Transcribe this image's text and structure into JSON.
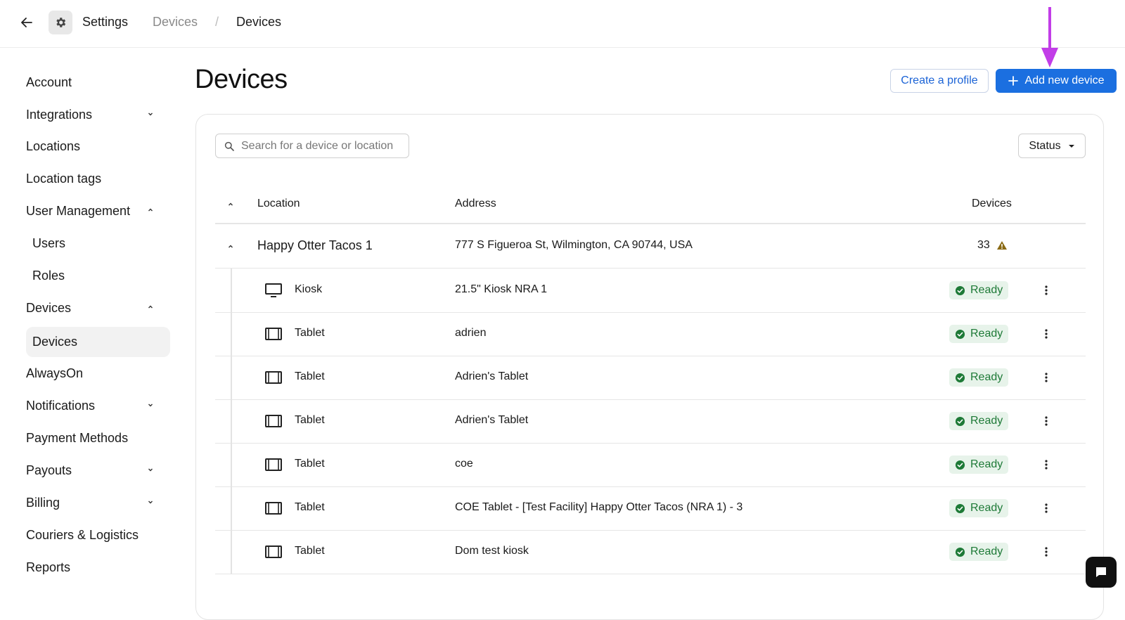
{
  "header": {
    "app_title": "Settings",
    "breadcrumb": [
      "Devices",
      "Devices"
    ],
    "breadcrumb_separator": "/"
  },
  "sidebar": {
    "items": [
      {
        "label": "Account",
        "chevron": "none"
      },
      {
        "label": "Integrations",
        "chevron": "down"
      },
      {
        "label": "Locations",
        "chevron": "none"
      },
      {
        "label": "Location tags",
        "chevron": "none"
      },
      {
        "label": "User Management",
        "chevron": "up"
      },
      {
        "label": "Users",
        "chevron": "none",
        "sub": true
      },
      {
        "label": "Roles",
        "chevron": "none",
        "sub": true
      },
      {
        "label": "Devices",
        "chevron": "up"
      },
      {
        "label": "Devices",
        "chevron": "none",
        "sub": true,
        "active": true
      },
      {
        "label": "AlwaysOn",
        "chevron": "none"
      },
      {
        "label": "Notifications",
        "chevron": "down"
      },
      {
        "label": "Payment Methods",
        "chevron": "none"
      },
      {
        "label": "Payouts",
        "chevron": "down"
      },
      {
        "label": "Billing",
        "chevron": "down"
      },
      {
        "label": "Couriers & Logistics",
        "chevron": "none"
      },
      {
        "label": "Reports",
        "chevron": "none"
      }
    ]
  },
  "main": {
    "title": "Devices",
    "create_profile_label": "Create a profile",
    "add_device_label": "Add new device",
    "search_placeholder": "Search for a device or location",
    "status_filter_label": "Status",
    "columns": {
      "location": "Location",
      "address": "Address",
      "devices": "Devices"
    },
    "group": {
      "location": "Happy Otter Tacos 1",
      "address": "777 S Figueroa St, Wilmington, CA 90744, USA",
      "device_count": "33",
      "warning": true
    },
    "rows": [
      {
        "type": "Kiosk",
        "icon": "monitor-icon",
        "name": "21.5\" Kiosk NRA 1",
        "status": "Ready"
      },
      {
        "type": "Tablet",
        "icon": "tablet-icon",
        "name": "adrien",
        "status": "Ready"
      },
      {
        "type": "Tablet",
        "icon": "tablet-icon",
        "name": "Adrien's Tablet",
        "status": "Ready"
      },
      {
        "type": "Tablet",
        "icon": "tablet-icon",
        "name": "Adrien's Tablet",
        "status": "Ready"
      },
      {
        "type": "Tablet",
        "icon": "tablet-icon",
        "name": "coe",
        "status": "Ready"
      },
      {
        "type": "Tablet",
        "icon": "tablet-icon",
        "name": "COE Tablet - [Test Facility] Happy Otter Tacos (NRA 1) - 3",
        "status": "Ready"
      },
      {
        "type": "Tablet",
        "icon": "tablet-icon",
        "name": "Dom test kiosk",
        "status": "Ready"
      }
    ]
  },
  "colors": {
    "accent": "#1b6fe0",
    "annotation_arrow": "#c23de8",
    "ready_text": "#1e7a37",
    "ready_bg": "#e7f3ea",
    "warning": "#8a6a14"
  }
}
